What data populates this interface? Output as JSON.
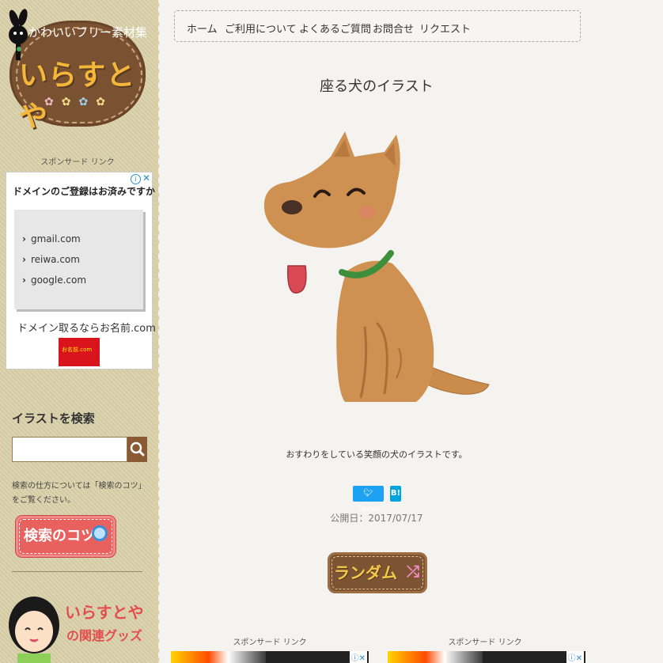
{
  "sidebar": {
    "logo": {
      "tagline": "かわいいフリー素材集",
      "title": "いらすとや"
    },
    "ad": {
      "sponsor_label": "スポンサード リンク",
      "title": "ドメインのご登録はお済みですか...",
      "domains": [
        "gmail.com",
        "reiwa.com",
        "google.com"
      ],
      "footer": "ドメイン取るならお名前.com",
      "banner_text": "お名前.com"
    },
    "search": {
      "heading": "イラストを検索",
      "placeholder": "",
      "help": "検索の仕方については「検索のコツ」をご覧ください。",
      "tips_button": "検索のコツ"
    },
    "goods": {
      "line1": "いらすとや",
      "line2": "の関連グッズ"
    }
  },
  "nav": {
    "items": [
      "ホーム",
      "ご利用について",
      "よくあるご質問",
      "お問合せ",
      "リクエスト"
    ]
  },
  "post": {
    "title": "座る犬のイラスト",
    "description": "おすわりをしている笑顔の犬のイラストです。",
    "tweet_label": "Tweet",
    "hatena_label": "B!",
    "date": "公開日：2017/07/17",
    "random_button": "ランダム"
  },
  "bottom_ads": {
    "left_label": "スポンサード リンク",
    "right_label": "スポンサード リンク"
  },
  "colors": {
    "sidebar_bg": "#d9d0a8",
    "logo_board": "#7a5232",
    "accent_red": "#e8615f",
    "twitter": "#1da1f2",
    "hatena": "#00a4de"
  }
}
